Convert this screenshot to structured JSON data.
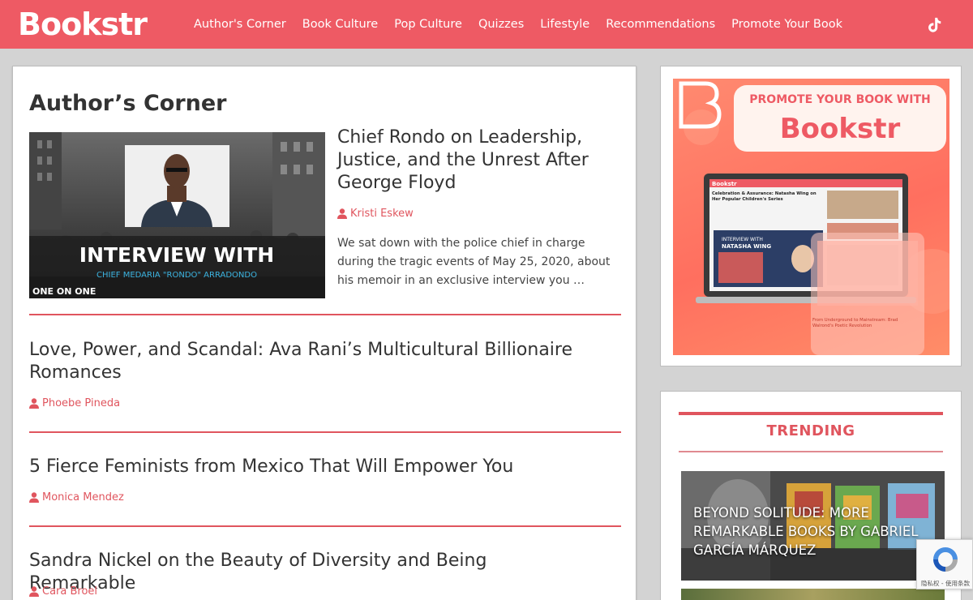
{
  "header": {
    "logo_text": "Bookstr",
    "nav": [
      "Author's Corner",
      "Book Culture",
      "Pop Culture",
      "Quizzes",
      "Lifestyle",
      "Recommendations",
      "Promote Your Book"
    ],
    "social_icon": "tiktok-icon",
    "brand_color": "#ee5a64"
  },
  "main": {
    "title": "Author’s Corner",
    "featured": {
      "title": "Chief Rondo on Leadership, Justice, and the Unrest After George Floyd",
      "author": "Kristi Eskew",
      "excerpt": "We sat down with the police chief in charge during the tragic events of May 25, 2020, about his memoir in an exclusive interview you …",
      "image_text_main": "INTERVIEW WITH",
      "image_text_sub": "CHIEF MEDARIA \"RONDO\" ARRADONDO",
      "image_badge": "ONE ON ONE"
    },
    "articles": [
      {
        "title": "Love, Power, and Scandal: Ava Rani’s Multicultural Billionaire Romances",
        "author": "Phoebe Pineda"
      },
      {
        "title": "5 Fierce Feminists from Mexico That Will Empower You",
        "author": "Monica Mendez"
      },
      {
        "title": "Sandra Nickel on the Beauty of Diversity and Being Remarkable",
        "author": "Cara Broel"
      }
    ]
  },
  "sidebar": {
    "ad": {
      "headline": "PROMOTE YOUR BOOK WITH",
      "logo_text": "Bookstr",
      "screen_logo": "Bookstr",
      "screen_headline": "Celebration & Assurance: Natasha Wing on Her Popular Children's Series",
      "screen_image_line1": "INTERVIEW WITH",
      "screen_image_line2": "NATASHA WING",
      "phone_headline": "From Underground to Mainstream: Brad Walrond's Poetic Revolution"
    },
    "trending": {
      "heading": "TRENDING",
      "items": [
        {
          "title": "BEYOND SOLITUDE: MORE REMARKABLE BOOKS BY GABRIEL GARCÍA MÁRQUEZ"
        }
      ]
    }
  },
  "recaptcha": {
    "text": "隐私权 - 使用条款"
  }
}
